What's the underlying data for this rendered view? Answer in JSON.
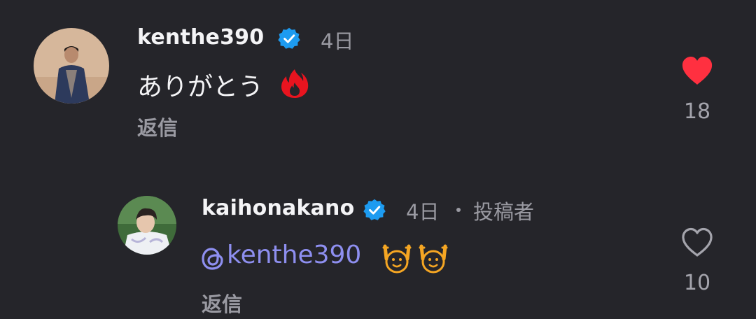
{
  "comments": [
    {
      "username": "kenthe390",
      "verified": true,
      "timestamp": "4日",
      "text": "ありがとう",
      "emoji": "fire",
      "reply_label": "返信",
      "liked": true,
      "like_count": "18"
    },
    {
      "username": "kaihonakano",
      "verified": true,
      "timestamp": "4日",
      "author_tag": "投稿者",
      "mention": "kenthe390",
      "emoji": "raising-hands-face x2",
      "reply_label": "返信",
      "liked": false,
      "like_count": "10"
    }
  ],
  "colors": {
    "background": "#25252a",
    "verified": "#1d9bf0",
    "liked_heart": "#ff3040",
    "mention": "#8e8ff0",
    "muted": "#9a9aa2"
  }
}
